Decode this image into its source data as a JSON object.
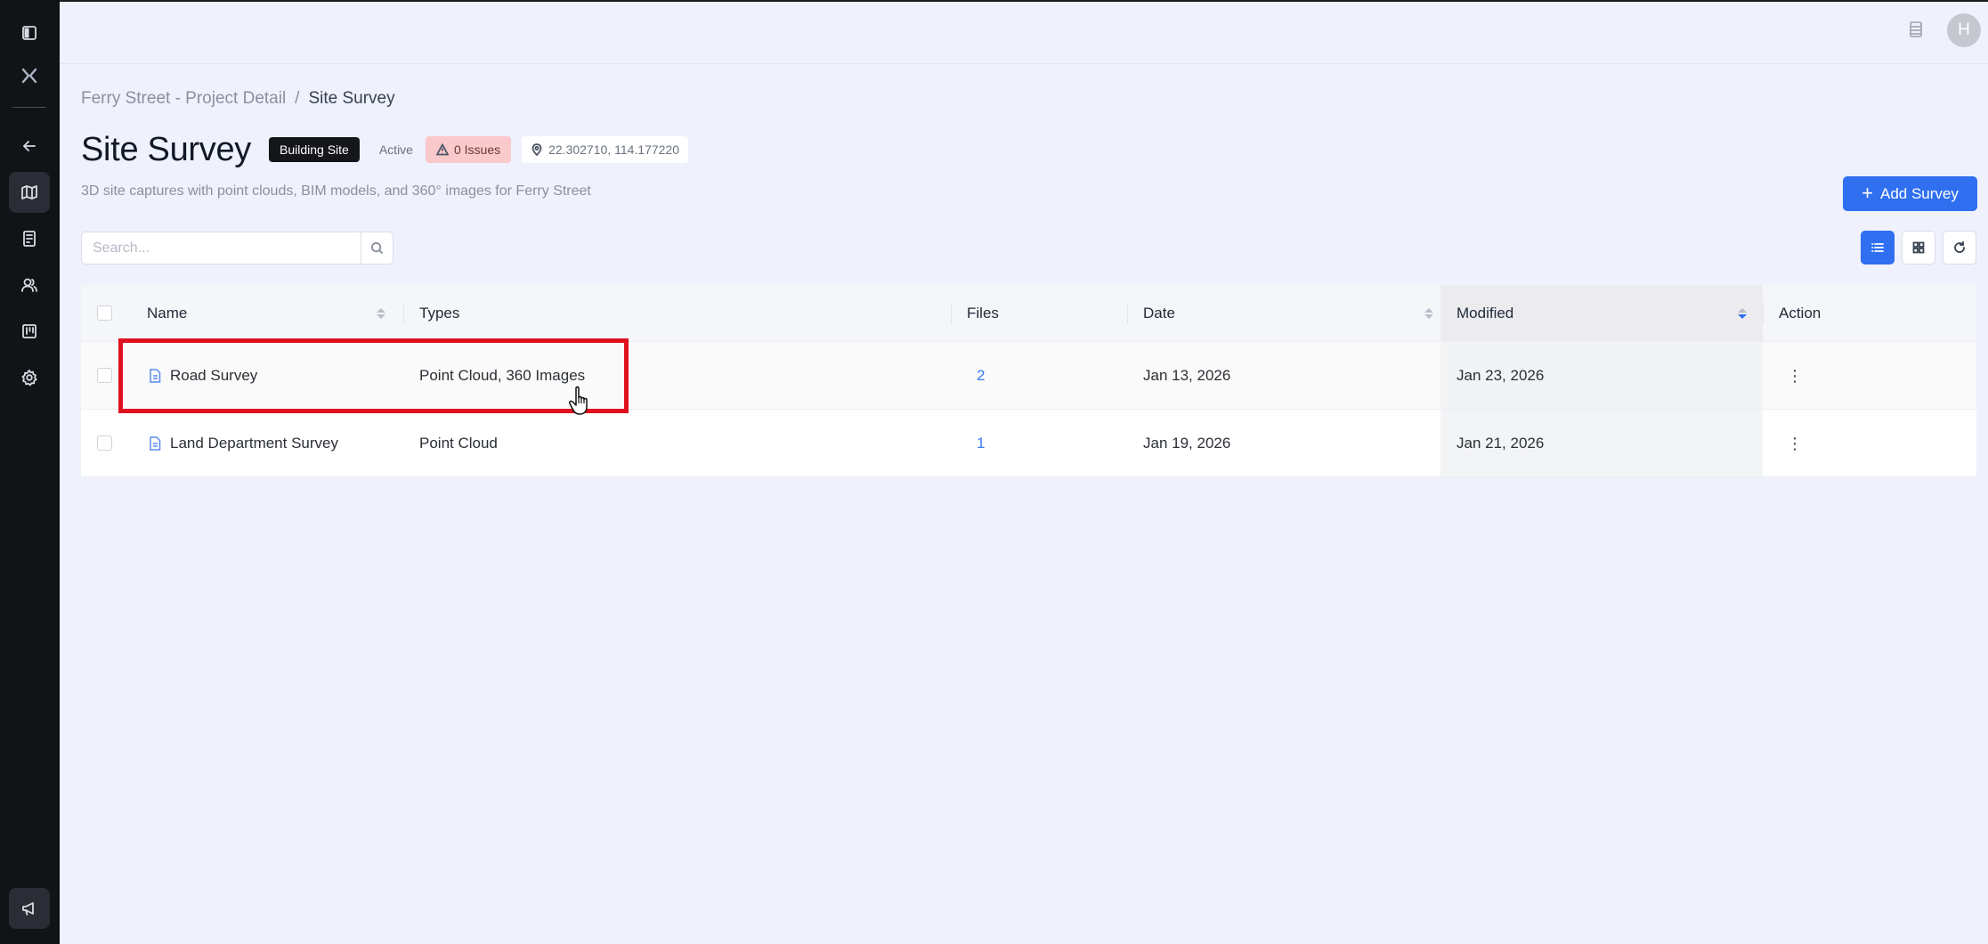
{
  "header": {
    "avatar_initial": "H"
  },
  "breadcrumb": {
    "parent": "Ferry Street - Project Detail",
    "separator": "/",
    "current": "Site Survey"
  },
  "page": {
    "title": "Site Survey",
    "category_badge": "Building Site",
    "status": "Active",
    "issues": "0 Issues",
    "coordinates": "22.302710, 114.177220",
    "subtitle": "3D site captures with point clouds, BIM models, and 360° images for Ferry Street"
  },
  "toolbar": {
    "add_label": "Add Survey",
    "search_placeholder": "Search...",
    "view_mode": "list"
  },
  "table": {
    "columns": [
      "Name",
      "Types",
      "Files",
      "Date",
      "Modified",
      "Action"
    ],
    "sorted_column": "Modified",
    "sort_direction": "descending",
    "rows": [
      {
        "name": "Road Survey",
        "types": "Point Cloud, 360 Images",
        "files": "2",
        "date": "Jan 13, 2026",
        "modified": "Jan 23, 2026",
        "action": "⋮"
      },
      {
        "name": "Land Department Survey",
        "types": "Point Cloud",
        "files": "1",
        "date": "Jan 19, 2026",
        "modified": "Jan 21, 2026",
        "action": "⋮"
      }
    ]
  },
  "colors": {
    "accent": "#2f6ff0",
    "sidebar": "#111317",
    "highlight": "#e0111f",
    "issues_bg": "#f9c9cb"
  },
  "icons": [
    "sidebar-toggle-icon",
    "logo-icon",
    "back-arrow-icon",
    "map-icon",
    "document-icon",
    "users-icon",
    "board-icon",
    "gear-icon",
    "megaphone-icon",
    "list-icon",
    "warning-icon",
    "location-pin-icon",
    "search-icon",
    "grid-icon",
    "refresh-icon",
    "file-icon"
  ]
}
